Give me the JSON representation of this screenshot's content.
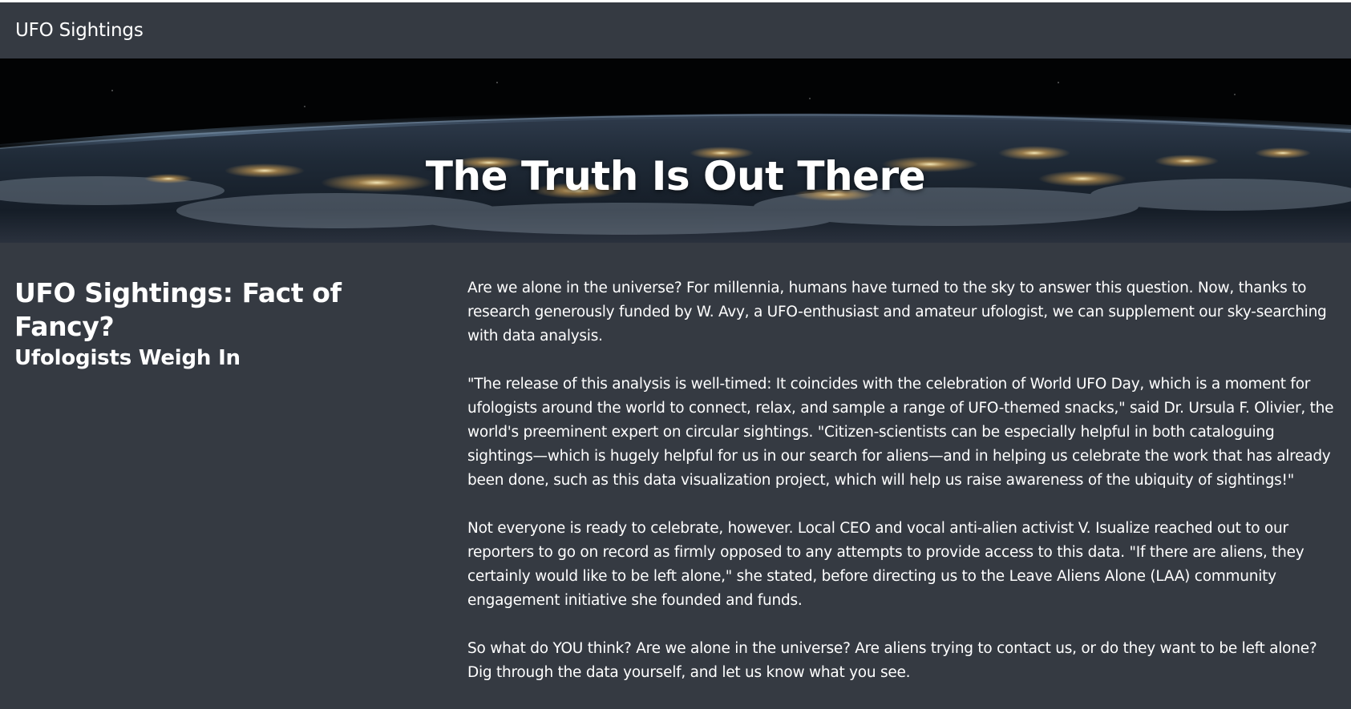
{
  "navbar": {
    "brand": "UFO Sightings"
  },
  "hero": {
    "title": "The Truth Is Out There"
  },
  "article": {
    "title": "UFO Sightings: Fact of Fancy?",
    "subtitle": "Ufologists Weigh In",
    "paragraphs": [
      "Are we alone in the universe? For millennia, humans have turned to the sky to answer this question. Now, thanks to research generously funded by W. Avy, a UFO-enthusiast and amateur ufologist, we can supplement our sky-searching with data analysis.",
      "\"The release of this analysis is well-timed: It coincides with the celebration of World UFO Day, which is a moment for ufologists around the world to connect, relax, and sample a range of UFO-themed snacks,\" said Dr. Ursula F. Olivier, the world's preeminent expert on circular sightings. \"Citizen-scientists can be especially helpful in both cataloguing sightings—which is hugely helpful for us in our search for aliens—and in helping us celebrate the work that has already been done, such as this data visualization project, which will help us raise awareness of the ubiquity of sightings!\"",
      "Not everyone is ready to celebrate, however. Local CEO and vocal anti-alien activist V. Isualize reached out to our reporters to go on record as firmly opposed to any attempts to provide access to this data. \"If there are aliens, they certainly would like to be left alone,\" she stated, before directing us to the Leave Aliens Alone (LAA) community engagement initiative she founded and funds.",
      "So what do YOU think? Are we alone in the universe? Are aliens trying to contact us, or do they want to be left alone? Dig through the data yourself, and let us know what you see."
    ]
  },
  "colors": {
    "background": "#353a42",
    "text": "#ffffff",
    "hero_background": "#000000"
  }
}
